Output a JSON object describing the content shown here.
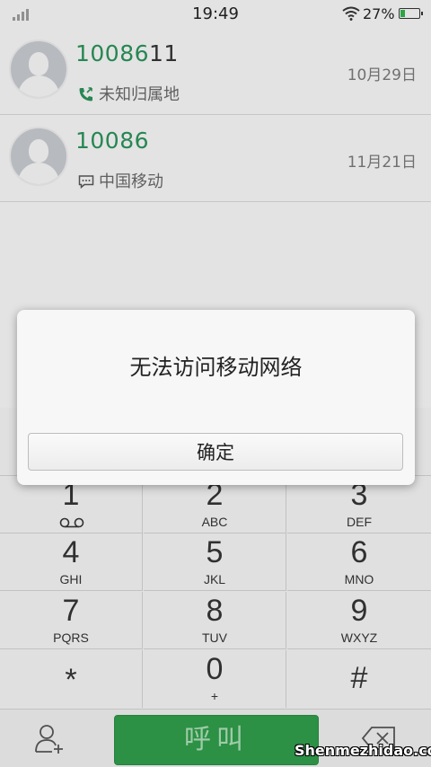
{
  "status_bar": {
    "time": "19:49",
    "battery_percent": "27%",
    "battery_level": 0.27,
    "icons": [
      "signal-icon",
      "wifi-icon",
      "battery-icon"
    ]
  },
  "call_log": [
    {
      "number_match": "10086",
      "number_rest": "11",
      "location": "未知归属地",
      "date": "10月29日",
      "sub_icon": "phone-callback-icon"
    },
    {
      "number_match": "10086",
      "number_rest": "",
      "location": "中国移动",
      "date": "11月21日",
      "sub_icon": "message-icon"
    }
  ],
  "keypad": {
    "keys": [
      {
        "digit": "1",
        "letters": ""
      },
      {
        "digit": "2",
        "letters": "ABC"
      },
      {
        "digit": "3",
        "letters": "DEF"
      },
      {
        "digit": "4",
        "letters": "GHI"
      },
      {
        "digit": "5",
        "letters": "JKL"
      },
      {
        "digit": "6",
        "letters": "MNO"
      },
      {
        "digit": "7",
        "letters": "PQRS"
      },
      {
        "digit": "8",
        "letters": "TUV"
      },
      {
        "digit": "9",
        "letters": "WXYZ"
      },
      {
        "digit": "*",
        "letters": ""
      },
      {
        "digit": "0",
        "letters": "+"
      },
      {
        "digit": "#",
        "letters": ""
      }
    ]
  },
  "bottom_bar": {
    "call_label": "呼叫",
    "call_color": "#2f9a4a"
  },
  "dialog": {
    "message": "无法访问移动网络",
    "ok_label": "确定"
  },
  "watermark": "Shenmezhidao.com",
  "colors": {
    "number_accent": "#2a8f58"
  }
}
